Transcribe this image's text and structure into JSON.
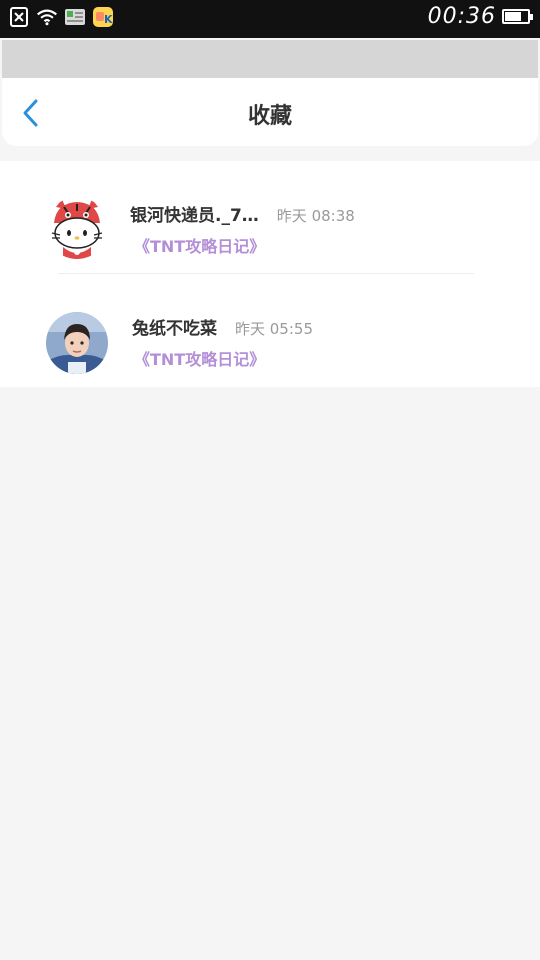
{
  "status_bar": {
    "time": "00:36",
    "battery_level": 0.75,
    "icons": [
      "sim-disabled-icon",
      "wifi-icon",
      "app-notification-icon",
      "app-k-icon"
    ]
  },
  "header": {
    "title": "收藏",
    "back_icon": "chevron-left-icon"
  },
  "items": [
    {
      "sender": "银河快递员._7…",
      "time": "昨天 08:38",
      "link": "《TNT攻略日记》",
      "avatar": "cartoon-cat-avatar"
    },
    {
      "sender": "兔纸不吃菜",
      "time": "昨天 05:55",
      "link": "《TNT攻略日记》",
      "avatar": "photo-avatar"
    }
  ],
  "colors": {
    "accent": "#2a8fdc",
    "link": "#b48fd8",
    "background": "#f5f5f5"
  }
}
